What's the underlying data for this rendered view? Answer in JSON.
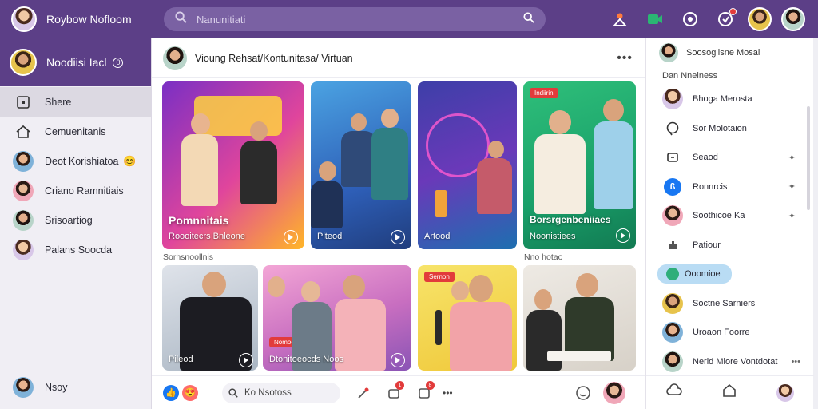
{
  "app": {
    "name": "Roybow Nofloom",
    "accent": "#5c3f87"
  },
  "search": {
    "placeholder": "Nanunitiati"
  },
  "top_icons": [
    "people-icon",
    "video-icon",
    "messenger-icon",
    "notifications-icon"
  ],
  "profile": {
    "name": "Noodiisi Iacl",
    "badge": "0"
  },
  "sidebar": {
    "items": [
      {
        "label": "Shere",
        "icon": "home-square-icon",
        "active": true
      },
      {
        "label": "Cemuenitanis",
        "icon": "home-outline-icon"
      },
      {
        "label": "Deot Korishiatoa",
        "icon": "avatar",
        "emoji": "😊"
      },
      {
        "label": "Criano Ramnitiais",
        "icon": "avatar"
      },
      {
        "label": "Srisoartiog",
        "icon": "avatar"
      },
      {
        "label": "Palans Soocda",
        "icon": "avatar"
      }
    ],
    "bottom_label": "Nsoy"
  },
  "main": {
    "header_title": "Vioung Rehsat/Kontunitasa/ Virtuan",
    "more": "•••",
    "cards_row1": [
      {
        "title": "Pomnnitais",
        "subtitle": "Roooitecrs Bnleone",
        "tag": ""
      },
      {
        "title": "",
        "subtitle": "Plteod",
        "tag": ""
      },
      {
        "title": "",
        "subtitle": "Artood",
        "tag": ""
      },
      {
        "title": "Borsrgenbeniiaes",
        "subtitle": "Noonistiees",
        "tag": "Indiirin"
      }
    ],
    "row_label_left": "Sorhsnoollnis",
    "row_label_right": "Nno hotao",
    "cards_row2": [
      {
        "subtitle": "Pileod",
        "tag": ""
      },
      {
        "subtitle": "Dtonitoeocds Noos",
        "tag": "Nomoeo"
      },
      {
        "subtitle": "",
        "tag": "Sernon"
      },
      {
        "subtitle": "",
        "tag": ""
      }
    ]
  },
  "bottom_bar": {
    "search_label": "Ko Nsotoss",
    "more": "•••",
    "counts": [
      "1",
      "8"
    ]
  },
  "right_panel": {
    "header": "Soosoglisne Mosal",
    "subheader": "Dan Nneiness",
    "items": [
      {
        "label": "Bhoga Merosta",
        "icon": "avatar"
      },
      {
        "label": "Sor Molotaion",
        "icon": "chat-icon"
      },
      {
        "label": "Seaod",
        "icon": "box-icon",
        "trail": "✦"
      },
      {
        "label": "Ronnrcis",
        "icon": "bluetooth-icon",
        "trail": "✦"
      },
      {
        "label": "Soothicoe Ka",
        "icon": "avatar",
        "trail": "✦"
      },
      {
        "label": "Patiour",
        "icon": "puzzle-icon"
      },
      {
        "label": "Ooomioe",
        "icon": "globe-icon",
        "highlight": true
      },
      {
        "label": "Soctne Sarniers",
        "icon": "avatar"
      },
      {
        "label": "Uroaon Foorre",
        "icon": "avatar"
      },
      {
        "label": "Nerld Mlore Vontdotat",
        "icon": "avatar",
        "trail": "•••"
      }
    ]
  }
}
